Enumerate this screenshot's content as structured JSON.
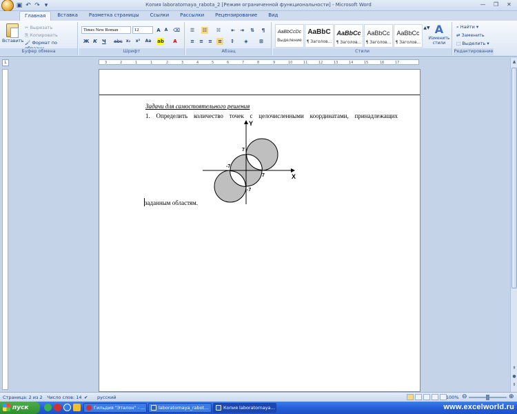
{
  "window": {
    "title": "Копия laboratornaya_rabota_2 [Режим ограниченной функциональности] - Microsoft Word"
  },
  "tabs": [
    "Главная",
    "Вставка",
    "Разметка страницы",
    "Ссылки",
    "Рассылки",
    "Рецензирование",
    "Вид"
  ],
  "ribbon": {
    "clipboard": {
      "paste": "Вставить",
      "cut": "Вырезать",
      "copy": "Копировать",
      "format_painter": "Формат по образцу",
      "label": "Буфер обмена"
    },
    "font": {
      "name": "Times New Roman",
      "size": "12",
      "label": "Шрифт"
    },
    "paragraph": {
      "label": "Абзац"
    },
    "styles": {
      "items": [
        {
          "sample": "AaBbCcDc",
          "name": "Выделение"
        },
        {
          "sample": "AaBbC",
          "name": "¶ Заголов..."
        },
        {
          "sample": "AaBbCc",
          "name": "¶ Заголов..."
        },
        {
          "sample": "AaBbCc",
          "name": "¶ Заголов..."
        },
        {
          "sample": "AaBbCc",
          "name": "¶ Заголов..."
        }
      ],
      "change_styles": "Изменить стили",
      "label": "Стили"
    },
    "editing": {
      "find": "Найти",
      "replace": "Заменить",
      "select": "Выделить",
      "label": "Редактирование"
    }
  },
  "ruler": {
    "marks": [
      "3",
      "2",
      "1",
      "1",
      "2",
      "3",
      "4",
      "5",
      "6",
      "7",
      "8",
      "9",
      "10",
      "11",
      "12",
      "13",
      "14",
      "15",
      "16",
      "17"
    ]
  },
  "document": {
    "heading": "Задачи для самостоятельного решения",
    "task": "1. Определить количество точек с целочисленными координатами, принадлежащих",
    "answer": "заданным областям.",
    "figure": {
      "x_label": "X",
      "y_label": "Y",
      "labels": {
        "top": "7",
        "left": "-7",
        "right": "7",
        "bottom": "-7"
      }
    }
  },
  "statusbar": {
    "page": "Страница: 2 из 2",
    "words": "Число слов: 14",
    "language": "русский",
    "zoom": "100%"
  },
  "taskbar": {
    "start": "пуск",
    "items": [
      "Гильдия \"Эталон\" - ...",
      "laboratornaya_rabot...",
      "Копия laboratornaya..."
    ],
    "watermark": "www.excelworld.ru"
  }
}
